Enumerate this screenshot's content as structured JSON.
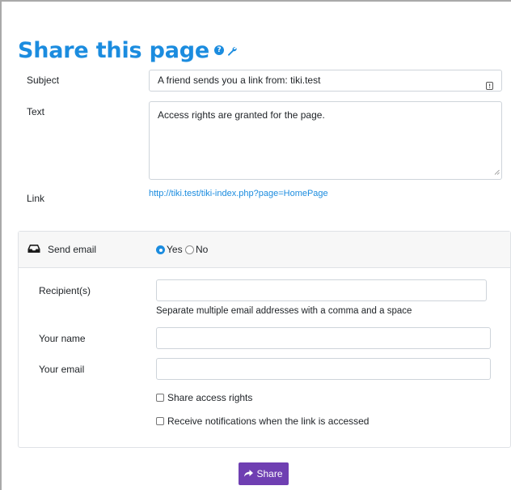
{
  "page": {
    "title": "Share this page",
    "help_glyph": "?",
    "help_icon": "question-circle-icon",
    "wrench_icon": "wrench-icon"
  },
  "form": {
    "subject_label": "Subject",
    "subject_value": "A friend sends you a link from:  tiki.test",
    "text_label": "Text",
    "text_value": "Access rights are granted for the page.",
    "link_label": "Link",
    "link_url": "http://tiki.test/tiki-index.php?page=HomePage"
  },
  "send_email": {
    "label": "Send email",
    "icon": "inbox-icon",
    "yes_label": "Yes",
    "no_label": "No",
    "selected": "Yes",
    "recipients_label": "Recipient(s)",
    "recipients_value": "",
    "recipients_help": "Separate multiple email addresses with a comma and a space",
    "your_name_label": "Your name",
    "your_name_value": "",
    "your_email_label": "Your email",
    "your_email_value": "",
    "share_access_label": "Share access rights",
    "notify_label": "Receive notifications when the link is accessed"
  },
  "actions": {
    "share_label": "Share",
    "share_icon": "share-arrow-icon"
  },
  "colors": {
    "title": "#1b8cdf",
    "link": "#1b8cdf",
    "share_button": "#6f3fb2",
    "card_header": "#f7f7f7"
  }
}
